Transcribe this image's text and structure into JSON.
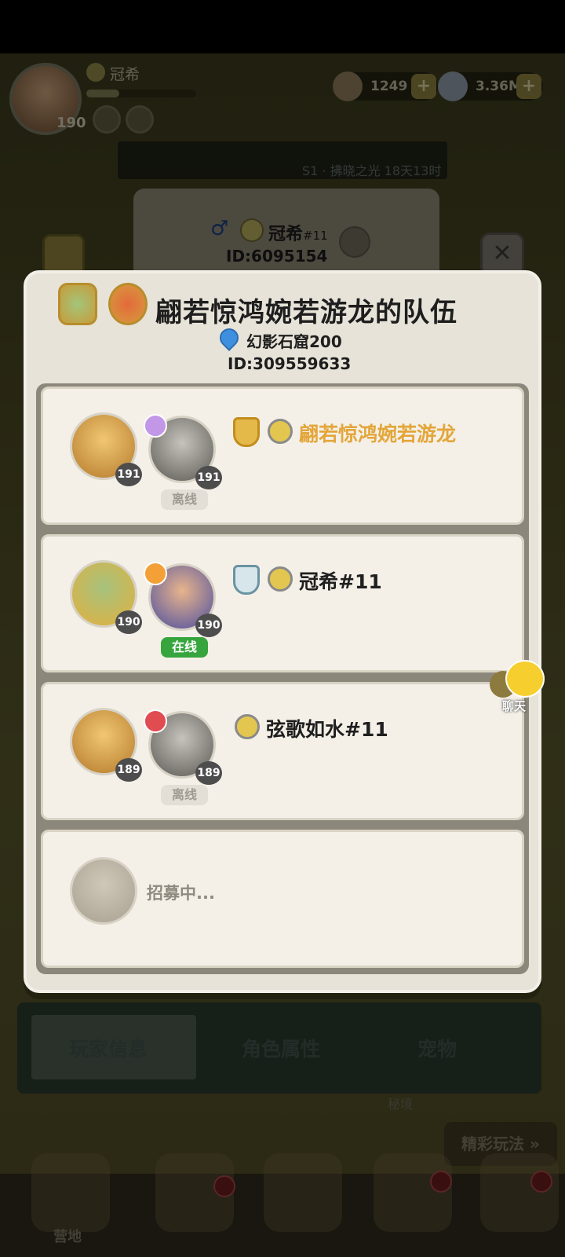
{
  "hud": {
    "player_name": "冠希",
    "level": "190",
    "resource_1": "1249",
    "resource_2": "3.36M",
    "plus": "+"
  },
  "season_text": "S1 · 拂晓之光 18天13时",
  "profile": {
    "gender_symbol": "♂",
    "name": "冠希",
    "name_tag": "#11",
    "id": "ID:6095154"
  },
  "close_symbol": "✕",
  "team": {
    "title": "翩若惊鸿婉若游龙的队伍",
    "location": "幻影石窟200",
    "id": "ID:309559633",
    "members": [
      {
        "pet_level": "191",
        "hero_level": "191",
        "status": "离线",
        "name": "翩若惊鸿婉若游龙",
        "is_leader": true,
        "class_color": "#c297e8"
      },
      {
        "pet_level": "190",
        "hero_level": "190",
        "status": "在线",
        "name": "冠希#11",
        "is_leader": false,
        "class_color": "#f3a036"
      },
      {
        "pet_level": "189",
        "hero_level": "189",
        "status": "离线",
        "name": "弦歌如水#11",
        "is_leader": false,
        "class_color": "#e04c50"
      }
    ],
    "recruiting_text": "招募中..."
  },
  "chat_label": "聊天",
  "tabs": [
    "玩家信息",
    "角色属性",
    "宠物"
  ],
  "secret_label": "秘境",
  "fun_button": "精彩玩法 »",
  "nav": {
    "camp_label": "营地"
  },
  "colors": {
    "leader_name": "#e3a63a",
    "online": "#36a53d",
    "offline_text": "#9f9b92"
  }
}
